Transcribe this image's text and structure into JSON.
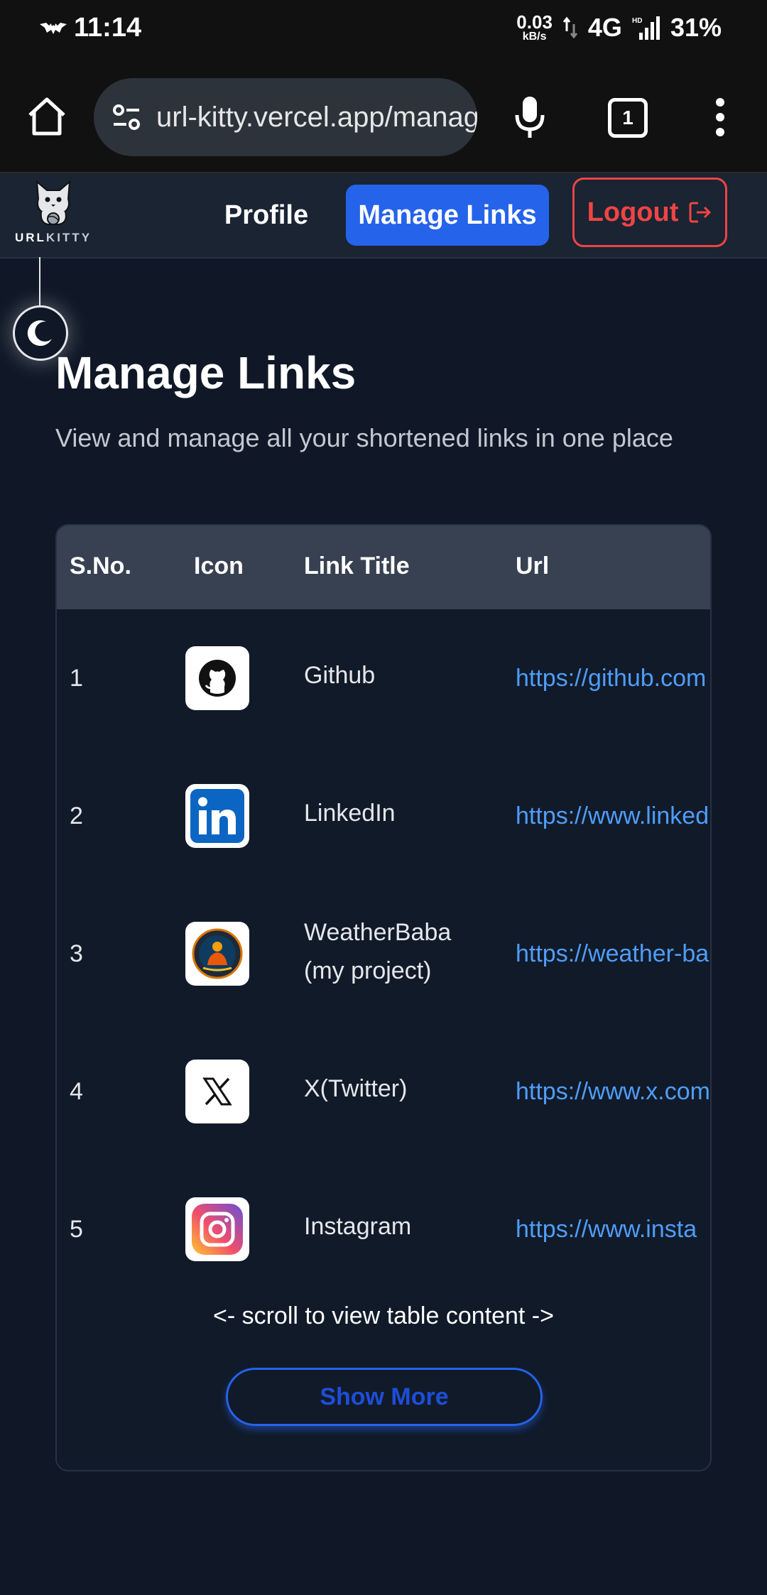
{
  "status_bar": {
    "time": "11:14",
    "speed_value": "0.03",
    "speed_unit": "kB/s",
    "network": "4G",
    "hd": "HD",
    "battery": "31%"
  },
  "browser": {
    "url": "url-kitty.vercel.app/manage",
    "tab_count": "1"
  },
  "header": {
    "brand_main": "URL",
    "brand_accent": "KITTY",
    "nav": {
      "profile": "Profile",
      "manage_links": "Manage Links",
      "logout": "Logout"
    }
  },
  "page": {
    "title": "Manage Links",
    "subtitle": "View and manage all your shortened links in one place"
  },
  "table": {
    "headers": [
      "S.No.",
      "Icon",
      "Link Title",
      "Url"
    ],
    "rows": [
      {
        "sno": "1",
        "icon": "github-icon",
        "title": "Github",
        "url": "https://github.com"
      },
      {
        "sno": "2",
        "icon": "linkedin-icon",
        "title": "LinkedIn",
        "url": "https://www.linked"
      },
      {
        "sno": "3",
        "icon": "weatherbaba-icon",
        "title": "WeatherBaba (my project)",
        "url": "https://weather-ba"
      },
      {
        "sno": "4",
        "icon": "x-twitter-icon",
        "title": "X(Twitter)",
        "url": "https://www.x.com"
      },
      {
        "sno": "5",
        "icon": "instagram-icon",
        "title": "Instagram",
        "url": "https://www.insta"
      }
    ],
    "scroll_hint": "<- scroll to view table content ->",
    "show_more": "Show More"
  },
  "colors": {
    "background": "#101827",
    "header": "#1a2433",
    "accent": "#2563eb",
    "danger": "#ef4444",
    "link": "#4f9df7"
  }
}
